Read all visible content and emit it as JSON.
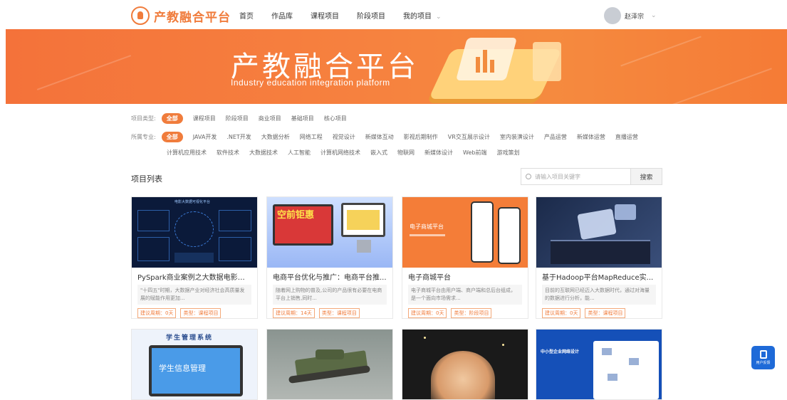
{
  "header": {
    "logo_text": "产教融合平台",
    "nav": [
      {
        "label": "首页"
      },
      {
        "label": "作品库"
      },
      {
        "label": "课程项目"
      },
      {
        "label": "阶段项目"
      },
      {
        "label": "我的项目",
        "dropdown": true
      }
    ],
    "user_name": "赵泽宗"
  },
  "banner": {
    "title": "产教融合平台",
    "subtitle": "Industry education integration platform"
  },
  "filters": {
    "type": {
      "label": "项目类型:",
      "options": [
        "全部",
        "课程项目",
        "阶段项目",
        "商业项目",
        "基础项目",
        "核心项目"
      ],
      "selected": "全部"
    },
    "major": {
      "label": "所属专业:",
      "options_row1": [
        "全部",
        "JAVA开发",
        ".NET开发",
        "大数据分析",
        "网络工程",
        "视觉设计",
        "新媒体互动",
        "影视后期制作",
        "VR交互展示设计",
        "室内装潢设计",
        "产品运营",
        "新媒体运营",
        "直播运营"
      ],
      "options_row2": [
        "计算机应用技术",
        "软件技术",
        "大数据技术",
        "人工智能",
        "计算机网络技术",
        "嵌入式",
        "物联网",
        "新媒体设计",
        "Web前端",
        "游戏策划"
      ],
      "selected": "全部"
    }
  },
  "list": {
    "title": "项目列表",
    "search_placeholder": "请输入项目关键字",
    "search_button": "搜索"
  },
  "cards": [
    {
      "title": "PySpark商业案例之大数据电影点...",
      "desc": "\"十四五\"时期，大数据产业对经济社会高质量发展的赋能作用更加...",
      "period": "建议周期：0天",
      "type": "类型：课程项目",
      "img_caption": "电影大数据可视化平台"
    },
    {
      "title": "电商平台优化与推广：电商平台推...",
      "desc": "随着网上购物的普及,公司的产品很有必要在电商平台上销售,同时...",
      "period": "建议周期：14天",
      "type": "类型：课程项目",
      "img_caption": "空前钜惠"
    },
    {
      "title": "电子商城平台",
      "desc": "电子商城平台由用户端、商户端和总后台组成，是一个面向市场需求...",
      "period": "建议周期：0天",
      "type": "类型：阶段项目",
      "img_caption": "电子商城平台"
    },
    {
      "title": "基于Hadoop平台MapReduce实...",
      "desc": "目前的互联网已经迈入大数据时代，通过对海量的数据进行分析，能...",
      "period": "建议周期：0天",
      "type": "类型：课程项目",
      "img_caption": ""
    }
  ],
  "cards_row2": [
    {
      "img_caption": "学生管理系统",
      "img_caption2": "学生信息管理"
    },
    {
      "img_caption": ""
    },
    {
      "img_caption": ""
    },
    {
      "img_caption": "中小型企业网络设计"
    }
  ],
  "feedback": {
    "label": "用户反馈"
  },
  "colors": {
    "accent": "#f07c3c",
    "feedback_blue": "#1e6ad8"
  }
}
